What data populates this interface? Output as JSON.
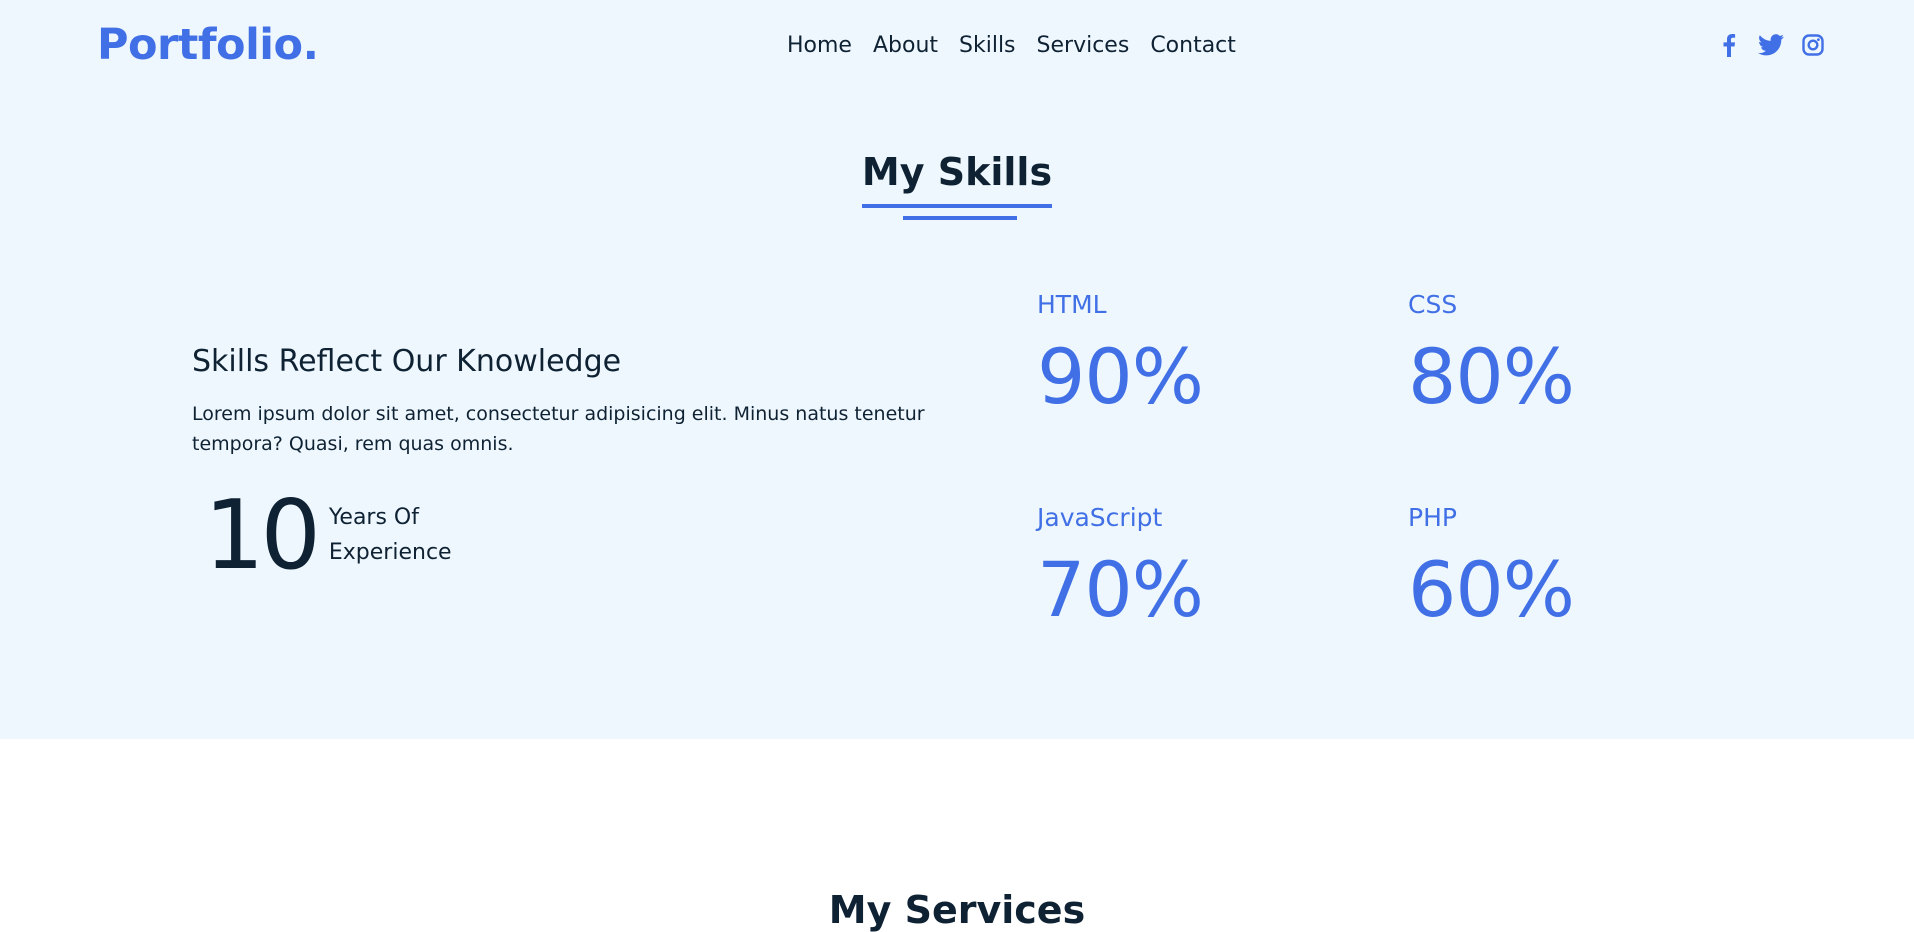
{
  "navbar": {
    "logo": "Portfolio.",
    "links": [
      "Home",
      "About",
      "Skills",
      "Services",
      "Contact"
    ],
    "social": [
      {
        "icon": "facebook-icon"
      },
      {
        "icon": "twitter-icon"
      },
      {
        "icon": "instagram-icon"
      }
    ]
  },
  "skills_section": {
    "title": "My Skills",
    "heading": "Skills Reflect Our Knowledge",
    "text": "Lorem ipsum dolor sit amet, consectetur adipisicing elit. Minus natus tenetur tempora? Quasi, rem quas omnis.",
    "experience_number": "10",
    "experience_label": "Years Of Experience",
    "skills": [
      {
        "name": "HTML",
        "value": "90%"
      },
      {
        "name": "CSS",
        "value": "80%"
      },
      {
        "name": "JavaScript",
        "value": "70%"
      },
      {
        "name": "PHP",
        "value": "60%"
      }
    ]
  },
  "next_section": {
    "title_partial": "My Services"
  },
  "colors": {
    "accent": "#4170e6",
    "text": "#0f2233",
    "section_bg": "#eef7fd"
  }
}
